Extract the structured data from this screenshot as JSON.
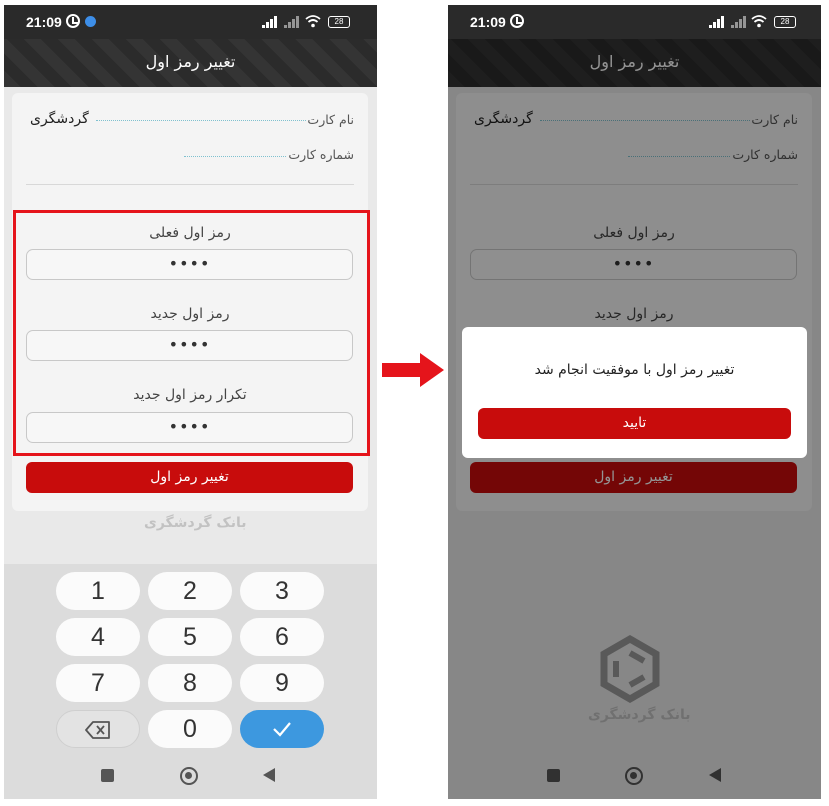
{
  "status": {
    "time": "21:09",
    "battery": "28"
  },
  "app": {
    "title": "تغییر رمز اول"
  },
  "card_info": {
    "name_label": "نام کارت",
    "name_value": "گردشگری",
    "number_label": "شماره کارت"
  },
  "form": {
    "current_label": "رمز اول فعلی",
    "current_value": "••••",
    "new_label": "رمز اول جدید",
    "new_value": "••••",
    "repeat_label": "تکرار رمز اول جدید",
    "repeat_value": "••••",
    "submit_label": "تغییر رمز اول"
  },
  "watermark": "بانک گردشگری",
  "keypad": {
    "keys": [
      "1",
      "2",
      "3",
      "4",
      "5",
      "6",
      "7",
      "8",
      "9",
      "0"
    ]
  },
  "dialog": {
    "message": "تغییر رمز اول با موفقیت انجام شد",
    "confirm_label": "تایید"
  },
  "colors": {
    "primary": "#c80c0c",
    "highlight": "#e5141b",
    "accent": "#3d98df"
  }
}
